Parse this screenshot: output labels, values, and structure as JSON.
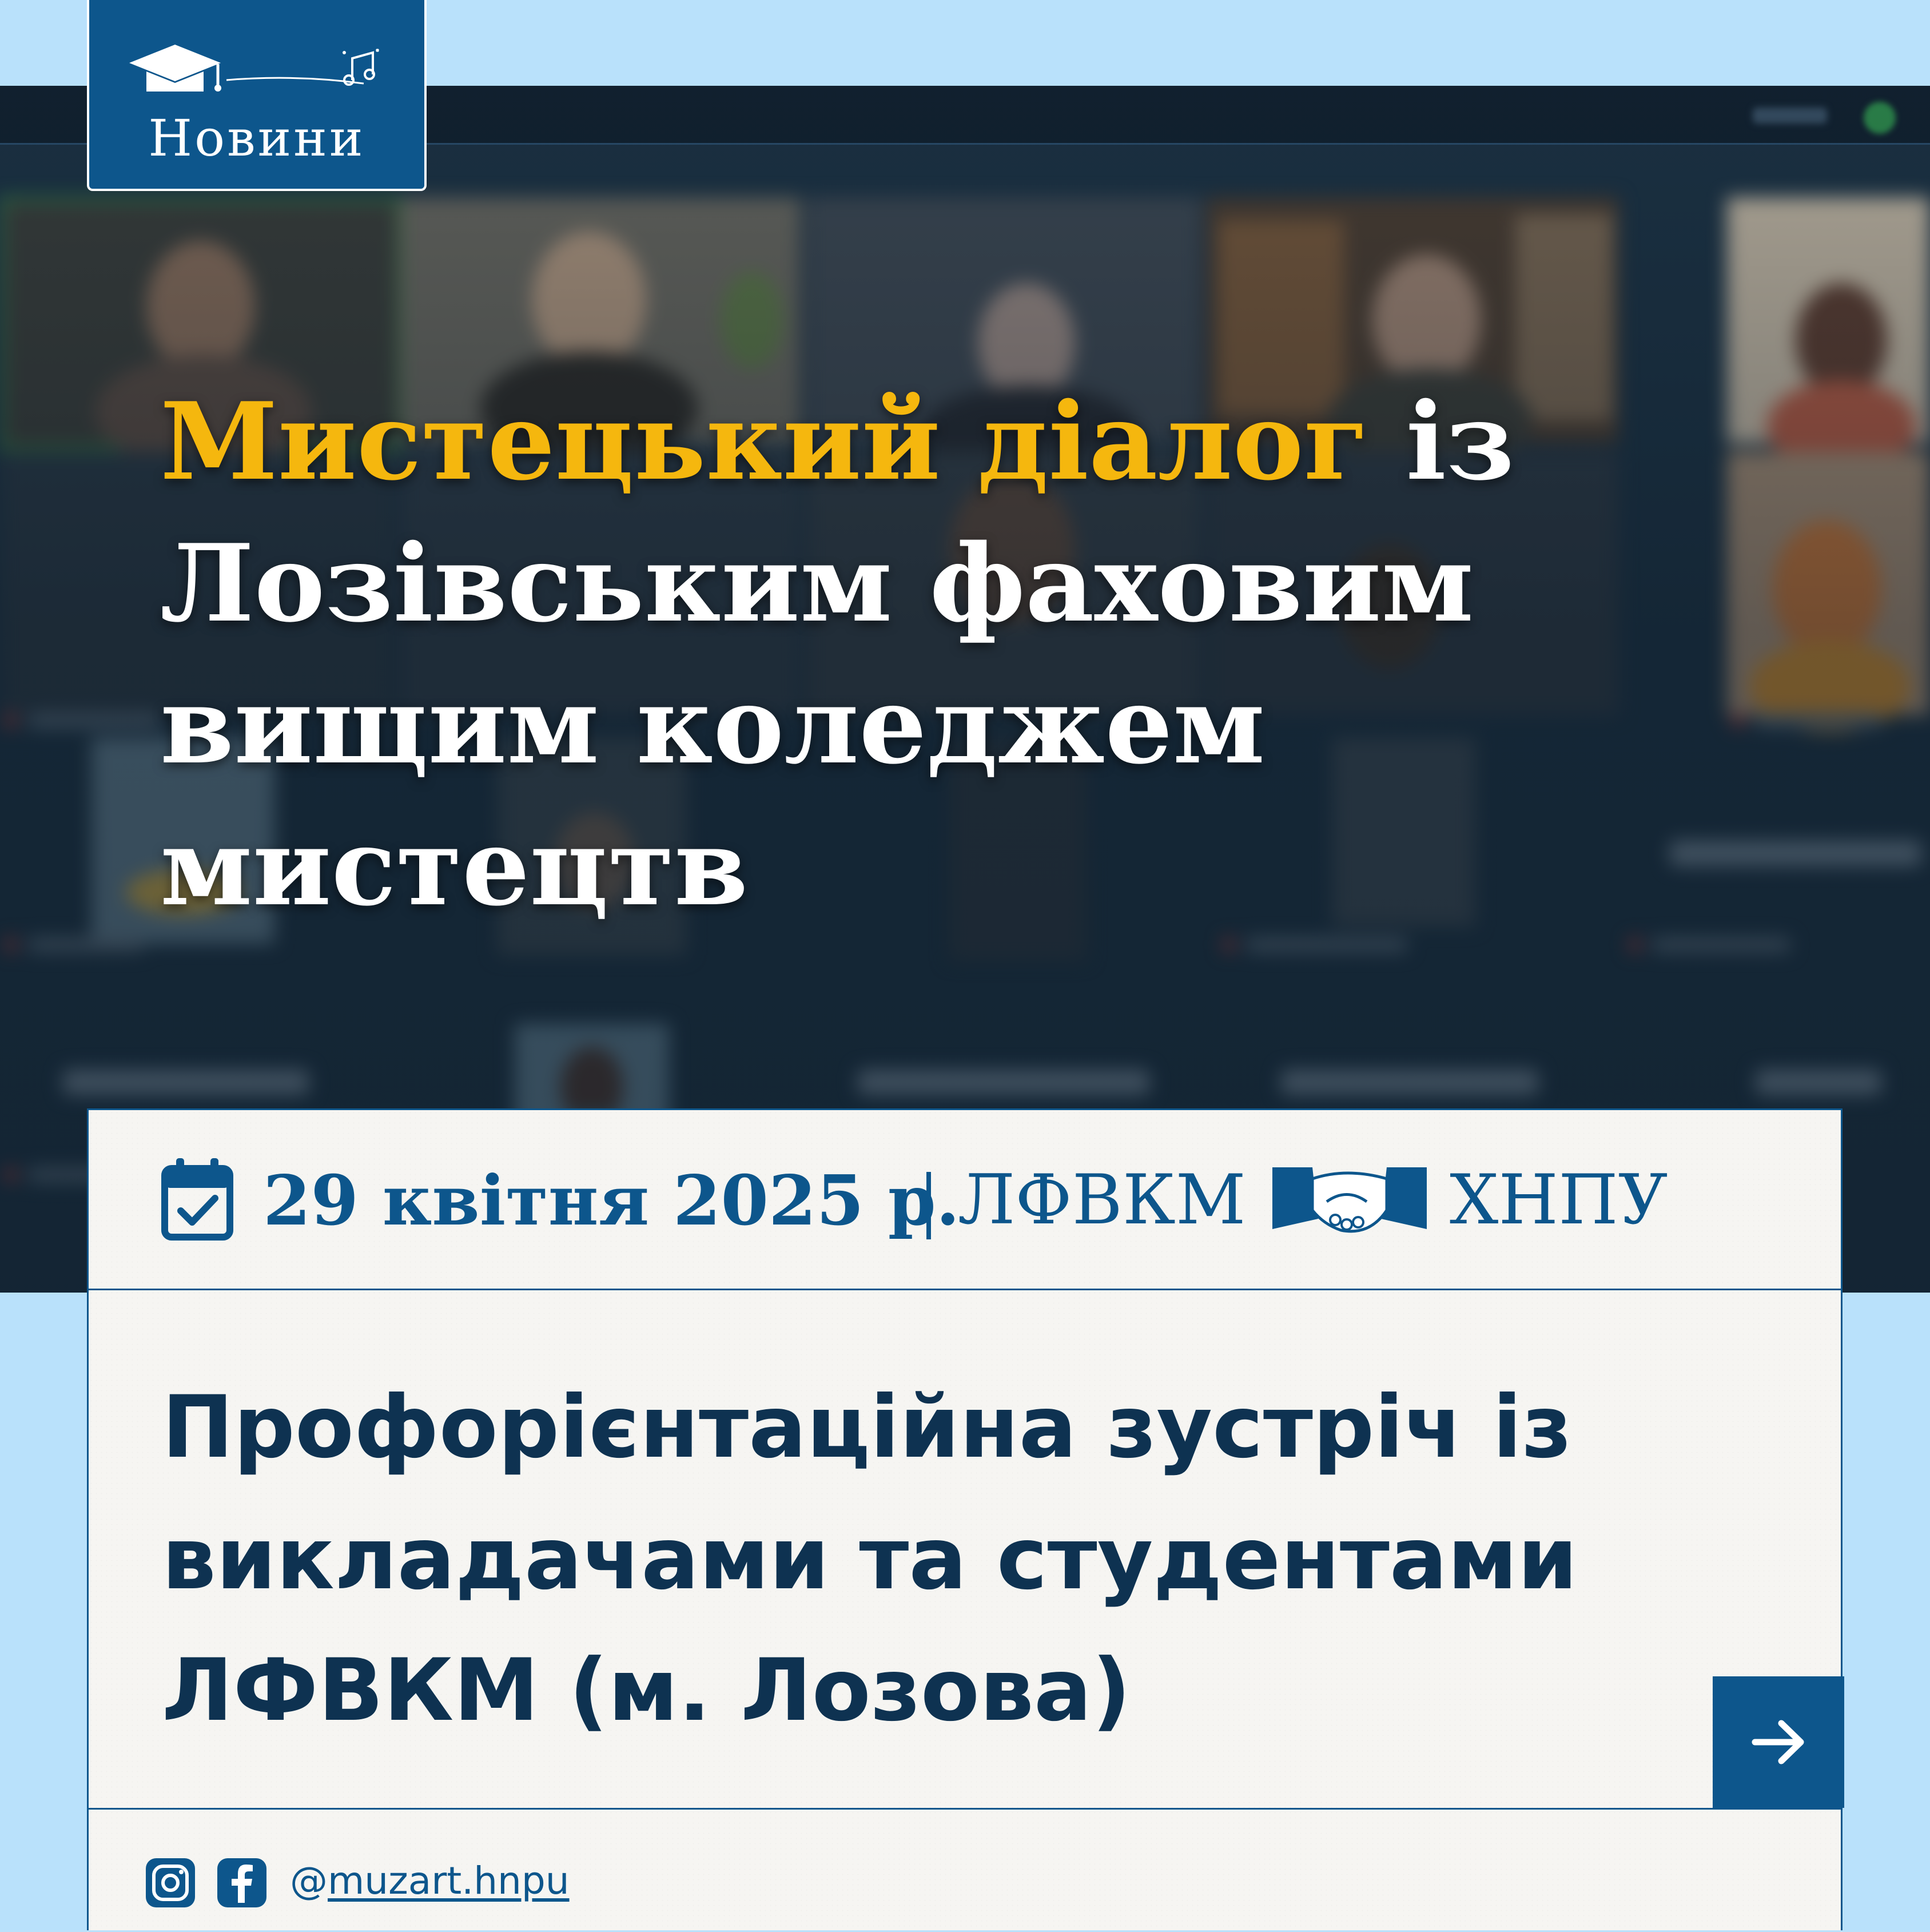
{
  "badge": {
    "label": "Новини",
    "icons": [
      "graduation-cap-icon",
      "music-notes-icon"
    ]
  },
  "headline": {
    "highlight": "Мистецький діалог",
    "rest": " із Лозівським фаховим вищим коледжем мистецтв"
  },
  "card": {
    "date": "29 квітня 2025 р.",
    "separator": "|",
    "org_left": "ЛФВКМ",
    "org_right": "ХНПУ",
    "icons": [
      "calendar-check-icon",
      "handshake-icon"
    ],
    "subtitle": "Профорієнтаційна зустріч із викладачами та студентами ЛФВКМ (м. Лозова)",
    "arrow_icon": "arrow-right-icon"
  },
  "footer": {
    "handle_prefix": "@",
    "handle": "muzart.hnpu",
    "icons": [
      "instagram-icon",
      "facebook-icon"
    ]
  },
  "colors": {
    "page_bg": "#b9e1fb",
    "brand_blue": "#0d568c",
    "headline_accent": "#f5b70e",
    "subtitle_text": "#0e3251",
    "card_bg": "#f6f5f2"
  }
}
